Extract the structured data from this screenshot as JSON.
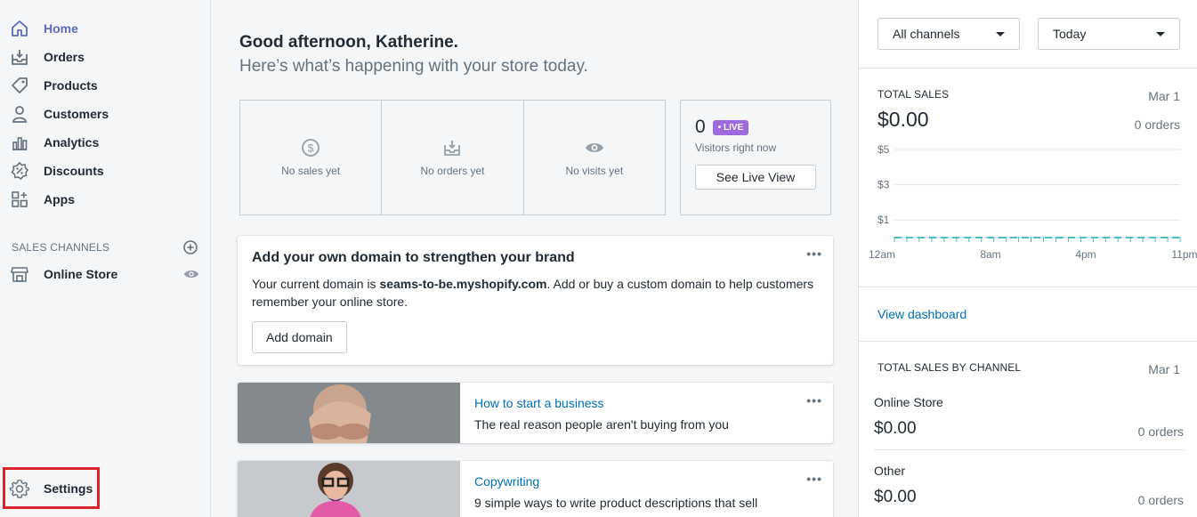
{
  "sidebar": {
    "items": [
      {
        "label": "Home",
        "icon": "home-icon",
        "active": true
      },
      {
        "label": "Orders",
        "icon": "orders-icon"
      },
      {
        "label": "Products",
        "icon": "tag-icon"
      },
      {
        "label": "Customers",
        "icon": "person-icon"
      },
      {
        "label": "Analytics",
        "icon": "bar-chart-icon"
      },
      {
        "label": "Discounts",
        "icon": "discount-icon"
      },
      {
        "label": "Apps",
        "icon": "apps-icon"
      }
    ],
    "sales_channels_title": "SALES CHANNELS",
    "online_store_label": "Online Store",
    "settings_label": "Settings",
    "accent": "#5c6ac4",
    "highlight_color": "#d8232a"
  },
  "main": {
    "greeting": "Good afternoon, Katherine.",
    "subgreeting": "Here’s what’s happening with your store today.",
    "stats": [
      {
        "label": "No sales yet",
        "icon": "dollar-circle-icon"
      },
      {
        "label": "No orders yet",
        "icon": "inbox-download-icon"
      },
      {
        "label": "No visits yet",
        "icon": "eye-icon"
      }
    ],
    "live": {
      "count": "0",
      "badge": "• LIVE",
      "label": "Visitors right now",
      "button": "See Live View",
      "badge_color": "#9c6ade"
    },
    "domain_card": {
      "title": "Add your own domain to strengthen your brand",
      "body_prefix": "Your current domain is ",
      "domain": "seams-to-be.myshopify.com",
      "body_suffix": ". Add or buy a custom domain to help customers remember your online store.",
      "button": "Add domain",
      "menu": "•••"
    },
    "articles": [
      {
        "category": "How to start a business",
        "title": "The real reason people aren't buying from you",
        "menu": "•••"
      },
      {
        "category": "Copywriting",
        "title": "9 simple ways to write product descriptions that sell",
        "menu": "•••"
      }
    ]
  },
  "right_panel": {
    "channel_select": "All channels",
    "date_select": "Today",
    "total_sales": {
      "title": "TOTAL SALES",
      "date": "Mar 1",
      "amount": "$0.00",
      "orders": "0 orders"
    },
    "view_dashboard": "View dashboard",
    "by_channel": {
      "title": "TOTAL SALES BY CHANNEL",
      "date": "Mar 1",
      "channels": [
        {
          "name": "Online Store",
          "amount": "$0.00",
          "orders": "0 orders"
        },
        {
          "name": "Other",
          "amount": "$0.00",
          "orders": "0 orders"
        }
      ]
    }
  },
  "chart_data": {
    "type": "line",
    "x": [
      "12am",
      "8am",
      "4pm",
      "11pm"
    ],
    "y_ticks": [
      "$5",
      "$3",
      "$1"
    ],
    "series": [
      {
        "values": [
          0,
          0,
          0,
          0,
          0,
          0,
          0,
          0,
          0,
          0,
          0,
          0,
          0,
          0,
          0,
          0,
          0,
          0,
          0,
          0,
          0,
          0,
          0,
          0
        ]
      }
    ],
    "ylim": [
      0,
      5
    ],
    "grid": true,
    "line_color": "#47c1bf"
  }
}
